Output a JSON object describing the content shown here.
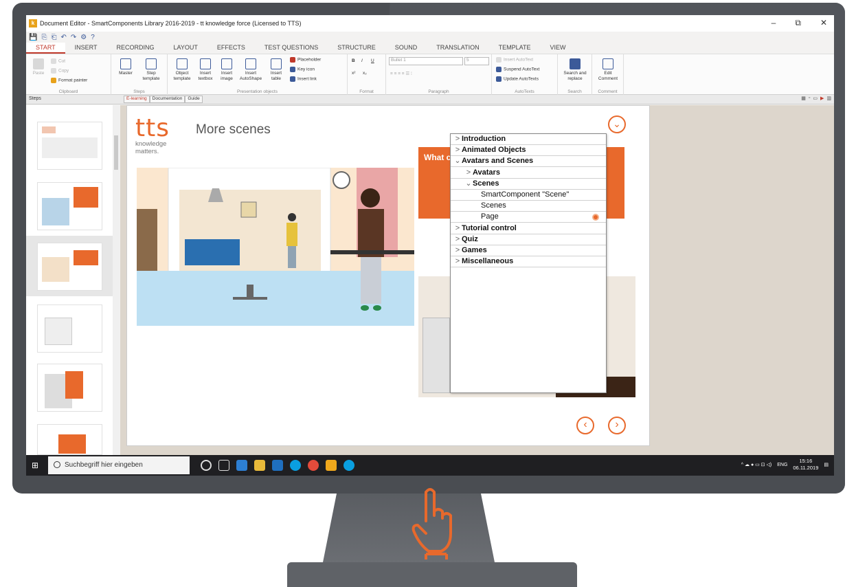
{
  "window": {
    "title": "Document Editor - SmartComponents Library 2016-2019 - tt knowledge force (Licensed to TTS)",
    "app_icon_letter": "k",
    "minimize": "–",
    "restore": "⧉",
    "close": "✕"
  },
  "quick_access": [
    "💾",
    "⎘",
    "⎗",
    "↶",
    "↷",
    "⚙",
    "?"
  ],
  "menu_tabs": [
    "START",
    "INSERT",
    "RECORDING",
    "LAYOUT",
    "EFFECTS",
    "TEST QUESTIONS",
    "STRUCTURE",
    "SOUND",
    "TRANSLATION",
    "TEMPLATE",
    "VIEW"
  ],
  "ribbon": {
    "clipboard": {
      "label": "Clipboard",
      "paste": "Paste",
      "cut": "Cut",
      "copy": "Copy",
      "format_painter": "Format painter"
    },
    "steps": {
      "label": "Steps",
      "master": "Master",
      "step_template": "Step template"
    },
    "presentation_objects": {
      "label": "Presentation objects",
      "object_template": "Object template",
      "insert_textbox": "Insert textbox",
      "insert_image": "Insert image",
      "insert_autoshape": "Insert AutoShape",
      "insert_table": "Insert table",
      "placeholder": "Placeholder",
      "key_icon": "Key icon",
      "insert_link": "Insert link"
    },
    "format": {
      "label": "Format",
      "bold": "B",
      "italic": "I",
      "underline": "U",
      "superscript": "x²",
      "subscript": "x₂"
    },
    "paragraph": {
      "label": "Paragraph",
      "style_value": "Bullet 1",
      "size_value": "5"
    },
    "autotexts": {
      "label": "AutoTexts",
      "insert_autotext": "Insert AutoText",
      "suspend_autotext": "Suspend AutoText",
      "update_autotexts": "Update AutoTexts"
    },
    "search": {
      "label": "Search",
      "search_replace": "Search and replace"
    },
    "comment": {
      "label": "Comment",
      "edit_comment": "Edit Comment"
    }
  },
  "panes": {
    "steps_label": "Steps",
    "doc_tabs": [
      "E-learning",
      "Documentation",
      "Guide"
    ]
  },
  "slide": {
    "logo": "tts",
    "tagline_1": "knowledge",
    "tagline_2": "matters.",
    "title": "More scenes",
    "card_text": "What c",
    "close_icon": "⌄",
    "prev": "‹",
    "next": "›"
  },
  "tree_menu": [
    {
      "label": "Introduction",
      "chevron": ">",
      "indent": 0,
      "bold": true
    },
    {
      "label": "Animated Objects",
      "chevron": ">",
      "indent": 0,
      "bold": true
    },
    {
      "label": "Avatars and Scenes",
      "chevron": "⌄",
      "indent": 0,
      "bold": true
    },
    {
      "label": "Avatars",
      "chevron": ">",
      "indent": 1,
      "bold": true
    },
    {
      "label": "Scenes",
      "chevron": "⌄",
      "indent": 1,
      "bold": true
    },
    {
      "label": "SmartComponent \"Scene\"",
      "chevron": "",
      "indent": 2,
      "bold": false
    },
    {
      "label": "Scenes",
      "chevron": "",
      "indent": 2,
      "bold": false
    },
    {
      "label": "Page",
      "chevron": "",
      "indent": 2,
      "bold": false,
      "marked": true
    },
    {
      "label": "Tutorial control",
      "chevron": ">",
      "indent": 0,
      "bold": true
    },
    {
      "label": "Quiz",
      "chevron": ">",
      "indent": 0,
      "bold": true
    },
    {
      "label": "Games",
      "chevron": ">",
      "indent": 0,
      "bold": true
    },
    {
      "label": "Miscellaneous",
      "chevron": ">",
      "indent": 0,
      "bold": true
    }
  ],
  "taskbar": {
    "search_placeholder": "Suchbegriff hier eingeben",
    "language": "ENG",
    "time": "15:16",
    "date": "06.11.2019"
  },
  "colors": {
    "accent": "#e8692c",
    "bezel": "#4a4d52",
    "taskbar": "#1f1f22"
  }
}
